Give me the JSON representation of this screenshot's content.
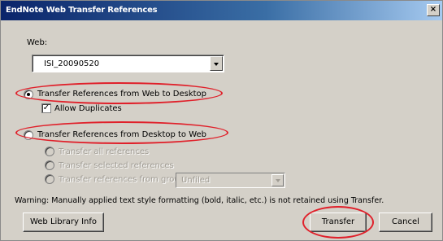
{
  "window": {
    "title": "EndNote Web Transfer References"
  },
  "web": {
    "label": "Web:",
    "selected": "ISI_20090520"
  },
  "options": {
    "to_desktop": "Transfer References from Web to Desktop",
    "allow_duplicates": "Allow Duplicates",
    "to_web": "Transfer References from Desktop to Web",
    "sub_option_1": "Transfer all references",
    "sub_option_2": "Transfer selected references",
    "sub_option_3": "Transfer references from group",
    "group_select": "Unfiled"
  },
  "warning": "Warning: Manually applied text style formatting (bold, italic, etc.) is not retained using Transfer.",
  "buttons": {
    "library_info": "Web Library Info",
    "transfer": "Transfer",
    "cancel": "Cancel"
  },
  "colors": {
    "annotation": "#e0202a",
    "titlebar": "#0a246a"
  }
}
